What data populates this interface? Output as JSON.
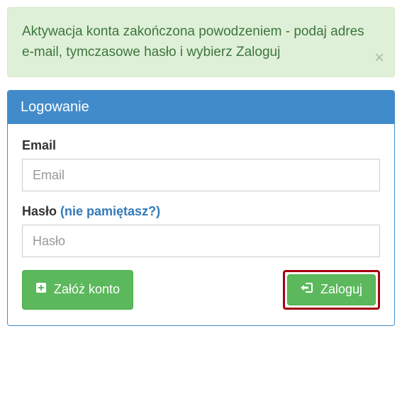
{
  "alert": {
    "message": "Aktywacja konta zakończona powodzeniem - podaj adres e-mail, tymczasowe hasło i wybierz Zaloguj",
    "close_label": "×"
  },
  "panel": {
    "title": "Logowanie"
  },
  "form": {
    "email": {
      "label": "Email",
      "placeholder": "Email",
      "value": ""
    },
    "password": {
      "label": "Hasło ",
      "forgot_text": "(nie pamiętasz?)",
      "placeholder": "Hasło",
      "value": ""
    }
  },
  "buttons": {
    "create_account": "Załóż konto",
    "login": "Zaloguj"
  },
  "colors": {
    "alert_bg": "#dff0d8",
    "alert_text": "#3c763d",
    "panel_accent": "#428bca",
    "btn_green": "#5cb85c",
    "highlight": "#a4000e"
  }
}
